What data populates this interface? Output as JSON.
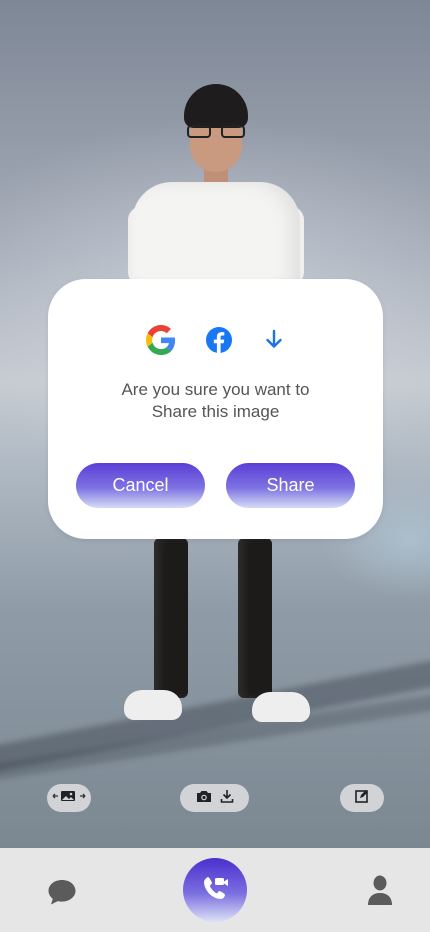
{
  "dialog": {
    "message_line1": "Are you sure you want to",
    "message_line2": "Share this image",
    "cancel_label": "Cancel",
    "share_label": "Share",
    "share_options": [
      {
        "icon": "google-icon"
      },
      {
        "icon": "facebook-icon"
      },
      {
        "icon": "download-icon"
      }
    ]
  },
  "toolbar": {
    "left_icon": "background-image-swap-icon",
    "middle_icons": [
      "camera-icon",
      "download-icon"
    ],
    "right_icon": "edit-icon"
  },
  "bottom_nav": {
    "left_icon": "chat-icon",
    "center_icon": "video-call-icon",
    "right_icon": "profile-icon"
  },
  "colors": {
    "accent_dark": "#4b2fcf",
    "accent_light": "#dde2f6",
    "facebook_blue": "#1877f2",
    "download_blue": "#1a73e8"
  }
}
